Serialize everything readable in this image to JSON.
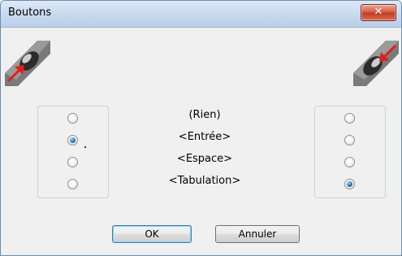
{
  "window": {
    "title": "Boutons"
  },
  "titlebar": {
    "close_glyph": "✕"
  },
  "icons": {
    "left": "mouse-left-button-icon",
    "right": "mouse-right-button-icon"
  },
  "options": [
    "(Rien)",
    "<Entrée>",
    "<Espace>",
    "<Tabulation>"
  ],
  "left_group": {
    "selected_index": 1,
    "selected_value": "<Entrée>"
  },
  "right_group": {
    "selected_index": 3,
    "selected_value": "<Tabulation>"
  },
  "buttons": {
    "ok_label": "OK",
    "cancel_label": "Annuler"
  },
  "colors": {
    "title_bar": "#c7d8ee",
    "close_button": "#c23a22",
    "radio_selected": "#1f6fb2",
    "arrow": "#e0201b"
  }
}
